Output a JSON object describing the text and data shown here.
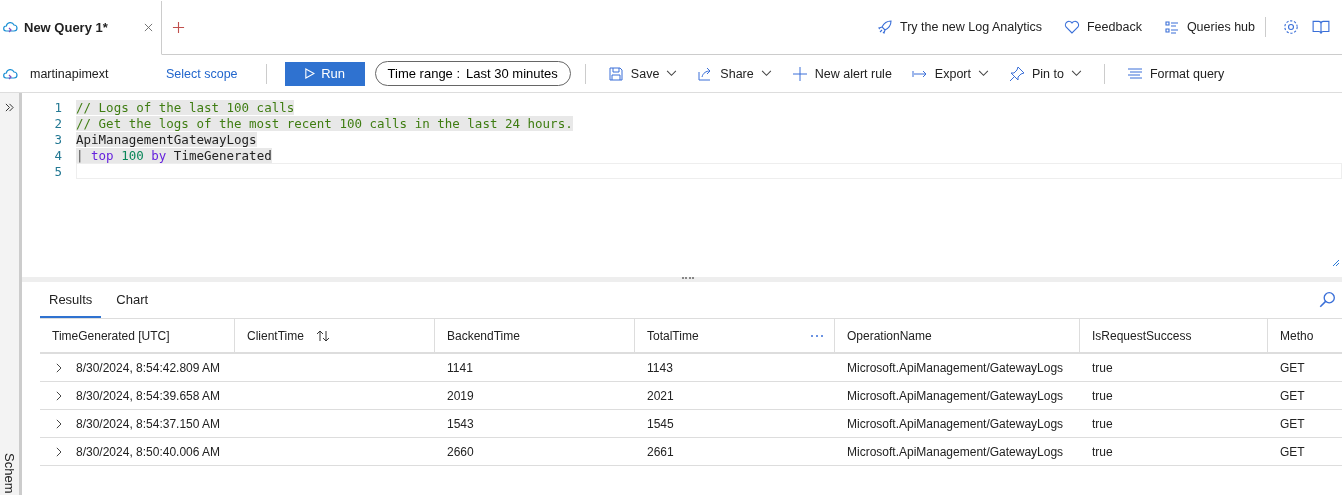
{
  "tab": {
    "title": "New Query 1*",
    "selected": true
  },
  "top_links": [
    {
      "kind": "rocket",
      "label": "Try the new Log Analytics"
    },
    {
      "kind": "heart",
      "label": "Feedback"
    },
    {
      "kind": "list",
      "label": "Queries hub"
    }
  ],
  "scope": {
    "name": "martinapimext",
    "link": "Select scope"
  },
  "run_button": "Run",
  "time_range": {
    "label": "Time range :",
    "value": "Last 30 minutes"
  },
  "toolbar": [
    {
      "kind": "save",
      "label": "Save",
      "dropdown": true
    },
    {
      "kind": "share",
      "label": "Share",
      "dropdown": true
    },
    {
      "kind": "plus",
      "label": "New alert rule",
      "dropdown": false
    },
    {
      "kind": "export",
      "label": "Export",
      "dropdown": true
    },
    {
      "kind": "pin",
      "label": "Pin to",
      "dropdown": true
    },
    {
      "kind": "format",
      "label": "Format query",
      "dropdown": false
    }
  ],
  "editor": {
    "lines": [
      {
        "number": "1",
        "tokens": [
          {
            "kind": "comment",
            "text": "// Logs of the last 100 calls"
          }
        ]
      },
      {
        "number": "2",
        "tokens": [
          {
            "kind": "comment",
            "text": "// Get the logs of the most recent 100 calls in the last 24 hours."
          }
        ]
      },
      {
        "number": "3",
        "tokens": [
          {
            "kind": "plain",
            "text": "ApiManagementGatewayLogs"
          }
        ]
      },
      {
        "number": "4",
        "tokens": [
          {
            "kind": "pipe",
            "text": "|"
          },
          {
            "kind": "keyword",
            "text": " top"
          },
          {
            "kind": "number",
            "text": " 100"
          },
          {
            "kind": "keyword",
            "text": " by"
          },
          {
            "kind": "plain",
            "text": " TimeGenerated"
          }
        ]
      },
      {
        "number": "5"
      }
    ]
  },
  "side_panel": {
    "label": "Schem"
  },
  "results_tabs": [
    {
      "label": "Results",
      "selected": true
    },
    {
      "label": "Chart",
      "selected": false
    }
  ],
  "table": {
    "columns": [
      {
        "label": "TimeGenerated [UTC]",
        "sort": false,
        "menu": false
      },
      {
        "label": "ClientTime",
        "sort": true,
        "menu": false
      },
      {
        "label": "BackendTime",
        "sort": false,
        "menu": false
      },
      {
        "label": "TotalTime",
        "sort": false,
        "menu": true
      },
      {
        "label": "OperationName",
        "sort": false,
        "menu": false
      },
      {
        "label": "IsRequestSuccess",
        "sort": false,
        "menu": false
      },
      {
        "label": "Metho",
        "sort": false,
        "menu": false
      }
    ],
    "rows": [
      [
        "8/30/2024, 8:54:42.809 AM",
        "",
        "1141",
        "1143",
        "Microsoft.ApiManagement/GatewayLogs",
        "true",
        "GET"
      ],
      [
        "8/30/2024, 8:54:39.658 AM",
        "",
        "2019",
        "2021",
        "Microsoft.ApiManagement/GatewayLogs",
        "true",
        "GET"
      ],
      [
        "8/30/2024, 8:54:37.150 AM",
        "",
        "1543",
        "1545",
        "Microsoft.ApiManagement/GatewayLogs",
        "true",
        "GET"
      ],
      [
        "8/30/2024, 8:50:40.006 AM",
        "",
        "2660",
        "2661",
        "Microsoft.ApiManagement/GatewayLogs",
        "true",
        "GET"
      ]
    ]
  }
}
